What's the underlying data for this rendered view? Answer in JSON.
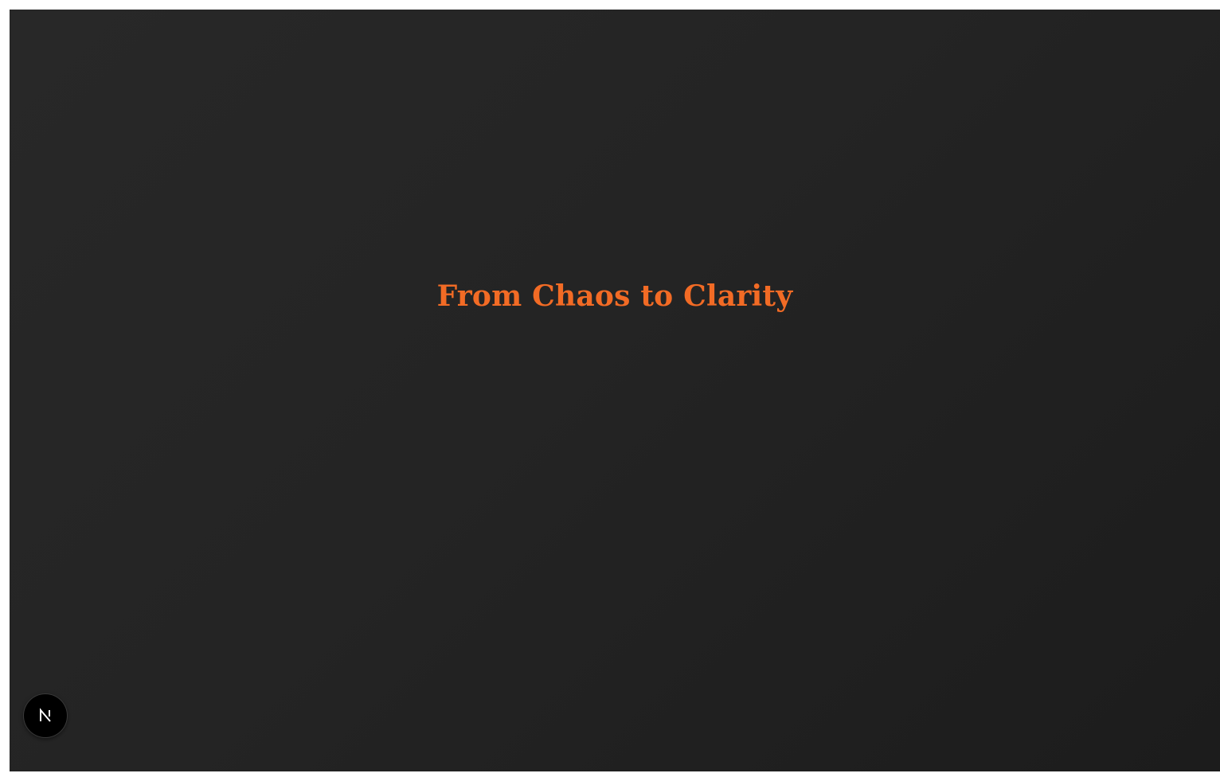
{
  "page": {
    "headline": "From Chaos to Clarity"
  },
  "devtools": {
    "icon": "nextjs-logo-icon",
    "letter": "N"
  },
  "colors": {
    "background": "#242424",
    "headline": "#f26b25",
    "badge": "#000000",
    "badge_letter": "#ffffff"
  }
}
